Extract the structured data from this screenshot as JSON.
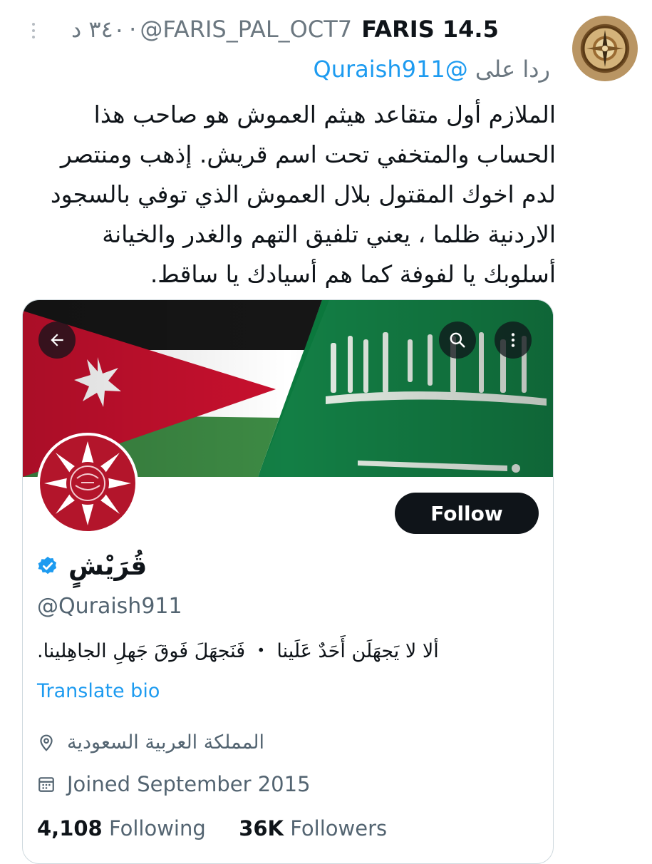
{
  "tweet": {
    "author_name": "FARIS 14.5",
    "author_handle": "@FARIS_PAL_OCT7",
    "time": "٣٤٠ د",
    "separator": "·",
    "reply_prefix": "ردا على",
    "reply_handle": "@Quraish911",
    "text_lines": [
      "الملازم أول متقاعد هيثم العموش هو صاحب هذا",
      "الحساب والمتخفي تحت اسم قريش.  إذهب ومنتصر",
      "لدم اخوك المقتول بلال العموش الذي توفي بالسجود",
      "الاردنية ظلما ، يعني تلفيق التهم والغدر والخيانة",
      "أسلوبك يا لفوفة كما هم أسيادك يا ساقط."
    ]
  },
  "profile_card": {
    "display_name": "قُرَيْشٍ",
    "handle": "@Quraish911",
    "bio": "ألا لا يَجهَلَن أَحَدٌ عَلَينا ・ فَنَجهَلَ فَوقَ جَهلِ الجاهِلينا.",
    "translate_label": "Translate bio",
    "location": "المملكة العربية السعودية",
    "joined": "Joined September 2015",
    "following_count": "4,108",
    "following_label": "Following",
    "followers_count": "36K",
    "followers_label": "Followers",
    "follow_button_label": "Follow",
    "banner_text_top": "لا إله إلا الله محمد رسول الله"
  },
  "icons": {
    "more": "more-vertical-icon",
    "back": "back-arrow-icon",
    "search": "search-icon",
    "menu": "more-vertical-icon",
    "verified": "verified-badge-icon",
    "location": "location-pin-icon",
    "calendar": "calendar-icon"
  },
  "colors": {
    "link": "#1d9bf0",
    "text": "#0f1419",
    "muted": "#536471",
    "follow_bg": "#0f1419",
    "jordan_red": "#c8102e",
    "saudi_green": "#0b7a3e"
  }
}
